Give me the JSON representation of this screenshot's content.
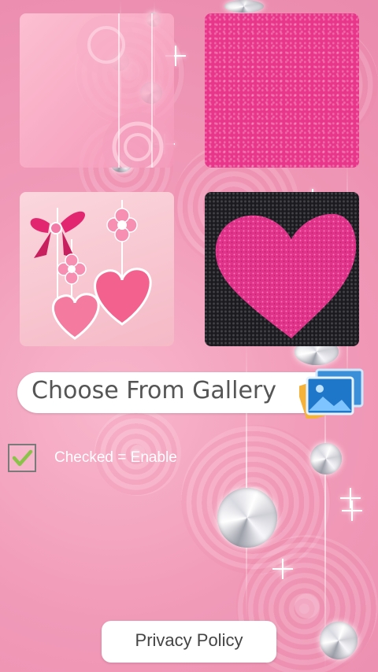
{
  "thumbnails": [
    {
      "name": "pink-roses-diamonds",
      "icon": "wallpaper-thumbnail"
    },
    {
      "name": "pink-glitter",
      "icon": "wallpaper-thumbnail"
    },
    {
      "name": "pink-hearts-bow",
      "icon": "wallpaper-thumbnail"
    },
    {
      "name": "glitter-heart-black",
      "icon": "wallpaper-thumbnail"
    }
  ],
  "gallery": {
    "label": "Choose From Gallery",
    "icon": "gallery-image-icon"
  },
  "enable_option": {
    "label": "Checked = Enable",
    "checked": true,
    "icon": "checkmark-icon"
  },
  "privacy": {
    "label": "Privacy Policy"
  },
  "colors": {
    "background": "#f19ab8",
    "glitter_pink": "#e8368a",
    "checkmark": "#8bc34a",
    "button_bg": "#ffffff"
  }
}
